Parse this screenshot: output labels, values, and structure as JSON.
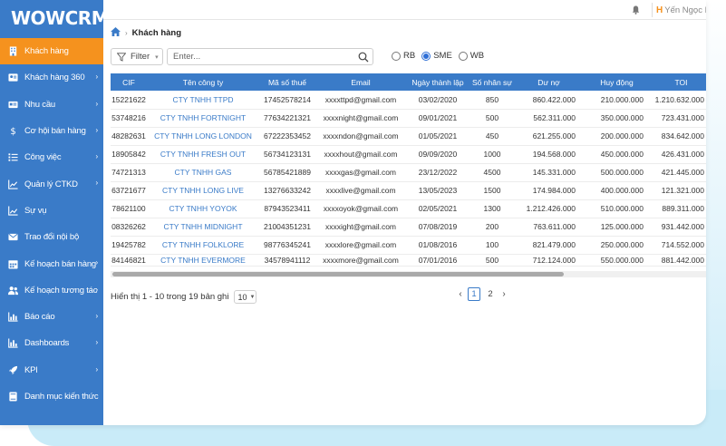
{
  "app": {
    "logo": "WOWCRM"
  },
  "sidebar": {
    "items": [
      {
        "label": "Khách hàng",
        "icon": "building-icon",
        "active": true,
        "chevron": false
      },
      {
        "label": "Khách hàng 360",
        "icon": "contact-card-icon",
        "active": false,
        "chevron": true
      },
      {
        "label": "Nhu cầu",
        "icon": "id-card-icon",
        "active": false,
        "chevron": true
      },
      {
        "label": "Cơ hội bán hàng",
        "icon": "dollar-icon",
        "active": false,
        "chevron": true
      },
      {
        "label": "Công việc",
        "icon": "task-list-icon",
        "active": false,
        "chevron": true
      },
      {
        "label": "Quản lý CTKD",
        "icon": "line-chart-icon",
        "active": false,
        "chevron": true
      },
      {
        "label": "Sự vụ",
        "icon": "chart-icon",
        "active": false,
        "chevron": false
      },
      {
        "label": "Trao đổi nội bộ",
        "icon": "mail-icon",
        "active": false,
        "chevron": false
      },
      {
        "label": "Kế hoạch bán hàng",
        "icon": "calendar-icon",
        "active": false,
        "chevron": true
      },
      {
        "label": "Kế hoạch tương tác",
        "icon": "users-icon",
        "active": false,
        "chevron": true
      },
      {
        "label": "Báo cáo",
        "icon": "bar-chart-icon",
        "active": false,
        "chevron": true
      },
      {
        "label": "Dashboards",
        "icon": "dashboard-icon",
        "active": false,
        "chevron": true
      },
      {
        "label": "KPI",
        "icon": "rocket-icon",
        "active": false,
        "chevron": true
      },
      {
        "label": "Danh mục kiến thức",
        "icon": "book-icon",
        "active": false,
        "chevron": false
      }
    ]
  },
  "topbar": {
    "user_name": "Yến Ngọc Ng",
    "user_logo": "H"
  },
  "breadcrumb": {
    "current": "Khách hàng"
  },
  "filter": {
    "label": "Filter"
  },
  "search": {
    "placeholder": "Enter..."
  },
  "segments": {
    "options": [
      {
        "label": "RB",
        "checked": false
      },
      {
        "label": "SME",
        "checked": true
      },
      {
        "label": "WB",
        "checked": false
      }
    ]
  },
  "table": {
    "columns": [
      "CIF",
      "Tên công ty",
      "Mã số thuế",
      "Email",
      "Ngày thành lập",
      "Số nhân sự",
      "Dư nợ",
      "Huy động",
      "TOI"
    ],
    "rows": [
      [
        "15221622",
        "CTY TNHH TTPD",
        "17452578214",
        "xxxxttpd@gmail.com",
        "03/02/2020",
        "850",
        "860.422.000",
        "210.000.000",
        "1.210.632.000"
      ],
      [
        "53748216",
        "CTY TNHH FORTNIGHT",
        "77634221321",
        "xxxxnight@gmail.com",
        "09/01/2021",
        "500",
        "562.311.000",
        "350.000.000",
        "723.431.000"
      ],
      [
        "48282631",
        "CTY TNHH LONG LONDON",
        "67222353452",
        "xxxxndon@gmail.com",
        "01/05/2021",
        "450",
        "621.255.000",
        "200.000.000",
        "834.642.000"
      ],
      [
        "18905842",
        "CTY TNHH FRESH OUT",
        "56734123131",
        "xxxxhout@gmail.com",
        "09/09/2020",
        "1000",
        "194.568.000",
        "450.000.000",
        "426.431.000"
      ],
      [
        "74721313",
        "CTY TNHH GAS",
        "56785421889",
        "xxxxgas@gmail.com",
        "23/12/2022",
        "4500",
        "145.331.000",
        "500.000.000",
        "421.445.000"
      ],
      [
        "63721677",
        "CTY TNHH LONG LIVE",
        "13276633242",
        "xxxxlive@gmail.com",
        "13/05/2023",
        "1500",
        "174.984.000",
        "400.000.000",
        "121.321.000"
      ],
      [
        "78621100",
        "CTY TNHH YOYOK",
        "87943523411",
        "xxxxoyok@gmail.com",
        "02/05/2021",
        "1300",
        "1.212.426.000",
        "510.000.000",
        "889.311.000"
      ],
      [
        "08326262",
        "CTY TNHH MIDNIGHT",
        "21004351231",
        "xxxxight@gmail.com",
        "07/08/2019",
        "200",
        "763.611.000",
        "125.000.000",
        "931.442.000"
      ],
      [
        "19425782",
        "CTY TNHH FOLKLORE",
        "98776345241",
        "xxxxlore@gmail.com",
        "01/08/2016",
        "100",
        "821.479.000",
        "250.000.000",
        "714.552.000"
      ],
      [
        "84146821",
        "CTY TNHH EVERMORE",
        "34578941112",
        "xxxxmore@gmail.com",
        "07/01/2016",
        "500",
        "712.124.000",
        "550.000.000",
        "881.442.000"
      ]
    ]
  },
  "footer": {
    "info": "Hiển thị 1 - 10 trong 19 bản ghi",
    "page_size": "10",
    "pages": [
      "1",
      "2"
    ],
    "current_page": "1"
  },
  "colors": {
    "sidebar": "#3a7bc8",
    "active": "#f5921e",
    "header": "#3a7bc8",
    "link": "#3a7bc8"
  }
}
